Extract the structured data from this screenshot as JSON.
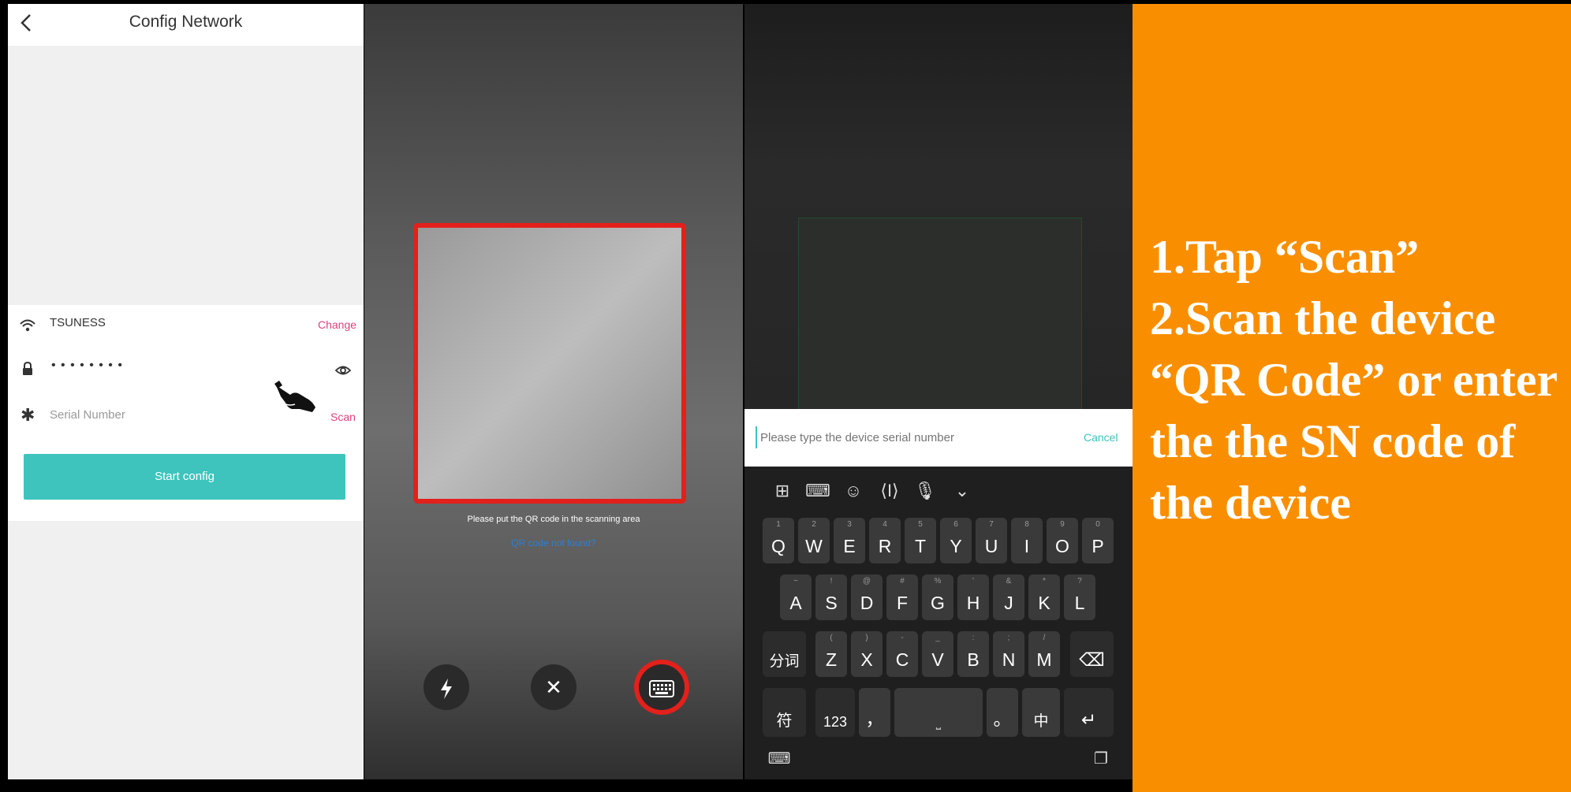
{
  "config_screen": {
    "title": "Config Network",
    "wifi_name": "TSUNESS",
    "change_label": "Change",
    "password_masked": "• • • • • • • •",
    "serial_placeholder": "Serial Number",
    "scan_label": "Scan",
    "start_button": "Start config"
  },
  "scan_screen": {
    "hint": "Please put the QR code in the scanning area",
    "not_found_link": "QR code not found?"
  },
  "keyboard_screen": {
    "input_placeholder": "Please type the device serial number",
    "cancel_label": "Cancel",
    "row1": [
      {
        "key": "Q",
        "sup": "1"
      },
      {
        "key": "W",
        "sup": "2"
      },
      {
        "key": "E",
        "sup": "3"
      },
      {
        "key": "R",
        "sup": "4"
      },
      {
        "key": "T",
        "sup": "5"
      },
      {
        "key": "Y",
        "sup": "6"
      },
      {
        "key": "U",
        "sup": "7"
      },
      {
        "key": "I",
        "sup": "8"
      },
      {
        "key": "O",
        "sup": "9"
      },
      {
        "key": "P",
        "sup": "0"
      }
    ],
    "row2": [
      {
        "key": "A",
        "sup": "~"
      },
      {
        "key": "S",
        "sup": "!"
      },
      {
        "key": "D",
        "sup": "@"
      },
      {
        "key": "F",
        "sup": "#"
      },
      {
        "key": "G",
        "sup": "%"
      },
      {
        "key": "H",
        "sup": "'"
      },
      {
        "key": "J",
        "sup": "&"
      },
      {
        "key": "K",
        "sup": "*"
      },
      {
        "key": "L",
        "sup": "?"
      }
    ],
    "row3": [
      {
        "key": "Z",
        "sup": "("
      },
      {
        "key": "X",
        "sup": ")"
      },
      {
        "key": "C",
        "sup": "-"
      },
      {
        "key": "V",
        "sup": "_"
      },
      {
        "key": "B",
        "sup": ":"
      },
      {
        "key": "N",
        "sup": ";"
      },
      {
        "key": "M",
        "sup": "/"
      }
    ],
    "fenci_label": "分词",
    "fu_label": "符",
    "num_label": "123",
    "comma_label": "，",
    "period_label": "。",
    "zhong_label": "中"
  },
  "instructions": {
    "line1": "1.Tap “Scan”",
    "line2": "2.Scan the device “QR Code” or enter the the SN code of the device"
  },
  "colors": {
    "accent_teal": "#3ec4bc",
    "accent_pink": "#e0417a",
    "highlight_red": "#e3201b",
    "instruction_bg": "#f98f00"
  }
}
